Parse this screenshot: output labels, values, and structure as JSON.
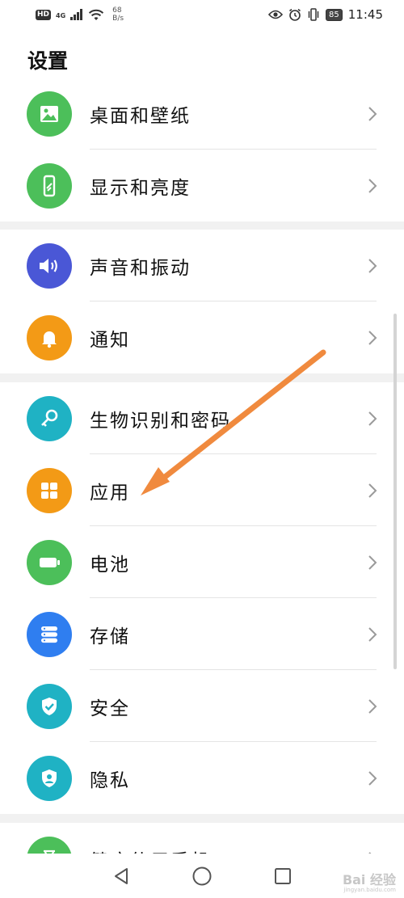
{
  "status_bar": {
    "hd": "HD",
    "network": "4G",
    "speed_value": "68",
    "speed_unit": "B/s",
    "battery": "85",
    "time": "11:45"
  },
  "header": {
    "title": "设置"
  },
  "groups": [
    {
      "items": [
        {
          "label": "桌面和壁纸",
          "icon": "wallpaper-icon",
          "color": "#4cbf5a"
        },
        {
          "label": "显示和亮度",
          "icon": "display-brightness-icon",
          "color": "#4cbf5a"
        }
      ]
    },
    {
      "items": [
        {
          "label": "声音和振动",
          "icon": "sound-icon",
          "color": "#4a57d6"
        },
        {
          "label": "通知",
          "icon": "bell-icon",
          "color": "#f39a16"
        }
      ]
    },
    {
      "items": [
        {
          "label": "生物识别和密码",
          "icon": "key-icon",
          "color": "#1fb2c4"
        },
        {
          "label": "应用",
          "icon": "apps-grid-icon",
          "color": "#f39a16"
        },
        {
          "label": "电池",
          "icon": "battery-icon",
          "color": "#4cbf5a"
        },
        {
          "label": "存储",
          "icon": "storage-icon",
          "color": "#2f7ef0"
        },
        {
          "label": "安全",
          "icon": "shield-check-icon",
          "color": "#1fb2c4"
        },
        {
          "label": "隐私",
          "icon": "privacy-icon",
          "color": "#1fb2c4"
        }
      ]
    },
    {
      "items": [
        {
          "label": "健康使用手机",
          "icon": "hourglass-icon",
          "color": "#4cbf5a"
        }
      ]
    }
  ],
  "annotation": {
    "arrow_color": "#f08a3e"
  },
  "watermark": {
    "text": "Bai 经验",
    "sub": "jingyan.baidu.com"
  }
}
